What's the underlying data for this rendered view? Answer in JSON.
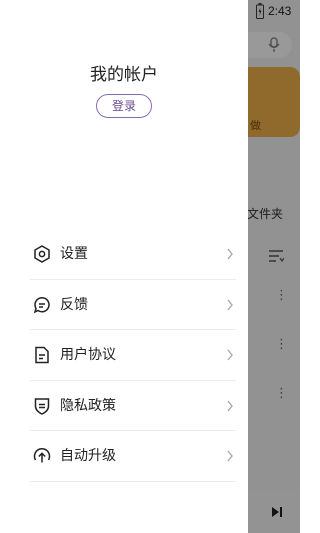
{
  "status_bar": {
    "time": "2:43",
    "icons": [
      "tiktok-icon",
      "image-icon",
      "notification-a-icon",
      "wifi-icon",
      "battery-icon"
    ]
  },
  "drawer": {
    "account_title": "我的帐户",
    "login_label": "登录",
    "menu": [
      {
        "label": "设置",
        "icon": "settings-hexagon-icon"
      },
      {
        "label": "反馈",
        "icon": "feedback-chat-icon"
      },
      {
        "label": "用户协议",
        "icon": "document-icon"
      },
      {
        "label": "隐私政策",
        "icon": "shield-icon"
      },
      {
        "label": "自动升级",
        "icon": "upgrade-icon"
      }
    ]
  },
  "background": {
    "banner_text": "做",
    "folder_text": "文件夹"
  },
  "colors": {
    "accent": "#6b4b96",
    "banner": "#f0b14a",
    "scrim": "rgba(0,0,0,0.40)"
  }
}
